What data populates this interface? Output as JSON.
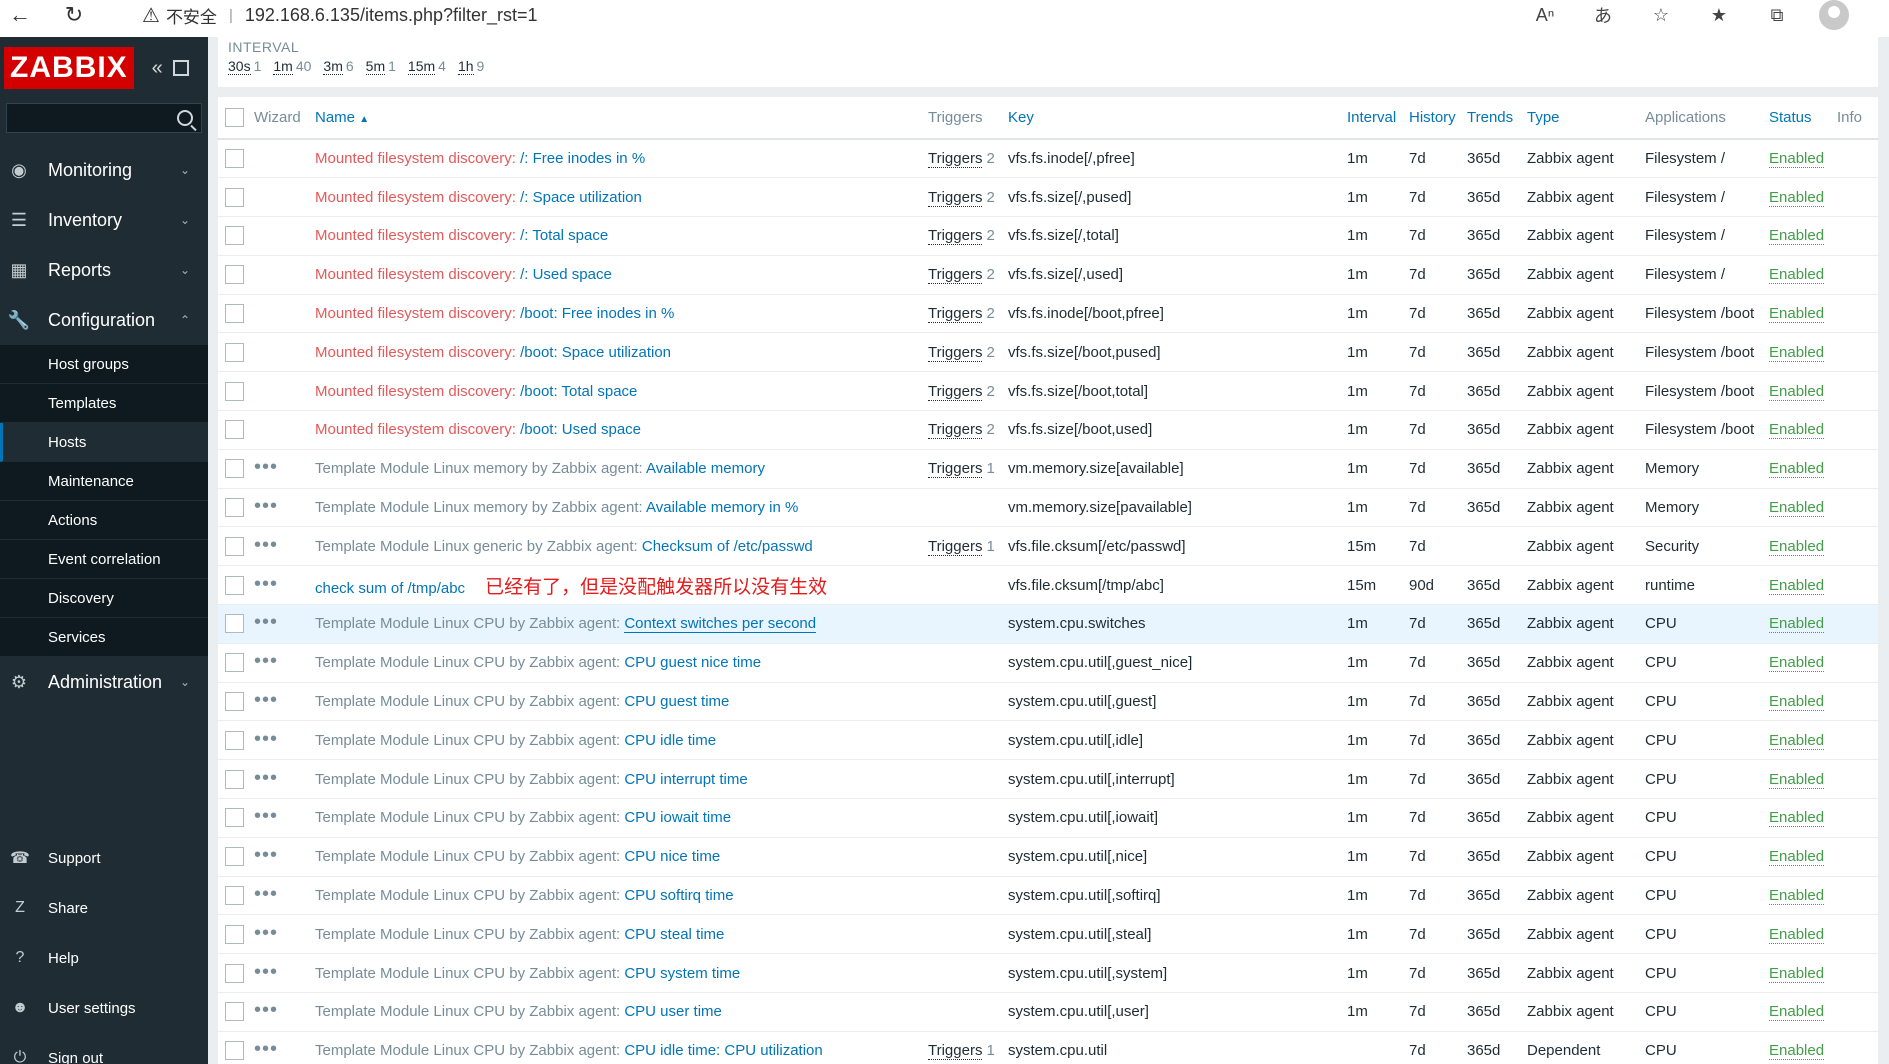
{
  "browser": {
    "security_label": "不安全",
    "url": "192.168.6.135/items.php?filter_rst=1"
  },
  "logo": "ZABBIX",
  "sidebar": {
    "menu": [
      {
        "label": "Monitoring",
        "icon": "eye-icon"
      },
      {
        "label": "Inventory",
        "icon": "list-icon"
      },
      {
        "label": "Reports",
        "icon": "bar-chart-icon"
      },
      {
        "label": "Configuration",
        "icon": "wrench-icon"
      }
    ],
    "config_submenu": [
      "Host groups",
      "Templates",
      "Hosts",
      "Maintenance",
      "Actions",
      "Event correlation",
      "Discovery",
      "Services"
    ],
    "admin": {
      "label": "Administration",
      "icon": "gear-icon"
    },
    "bottom": [
      {
        "label": "Support",
        "icon": "headset-icon"
      },
      {
        "label": "Share",
        "icon": "share-icon"
      },
      {
        "label": "Help",
        "icon": "question-icon"
      },
      {
        "label": "User settings",
        "icon": "user-icon"
      },
      {
        "label": "Sign out",
        "icon": "power-icon"
      }
    ]
  },
  "filter": {
    "interval_label": "INTERVAL",
    "intervals": [
      {
        "name": "30s",
        "count": "1"
      },
      {
        "name": "1m",
        "count": "40"
      },
      {
        "name": "3m",
        "count": "6"
      },
      {
        "name": "5m",
        "count": "1"
      },
      {
        "name": "15m",
        "count": "4"
      },
      {
        "name": "1h",
        "count": "9"
      }
    ]
  },
  "table": {
    "headers": {
      "wizard": "Wizard",
      "name": "Name",
      "triggers": "Triggers",
      "key": "Key",
      "interval": "Interval",
      "history": "History",
      "trends": "Trends",
      "type": "Type",
      "applications": "Applications",
      "status": "Status",
      "info": "Info"
    },
    "annotation": "已经有了，但是没配触发器所以没有生效",
    "rows": [
      {
        "prefix": "Mounted filesystem discovery:",
        "prefix_style": "red",
        "name": "/: Free inodes in %",
        "wizard": false,
        "triggers": "Triggers",
        "trig_count": "2",
        "key": "vfs.fs.inode[/,pfree]",
        "interval": "1m",
        "history": "7d",
        "trends": "365d",
        "type": "Zabbix agent",
        "app": "Filesystem /",
        "status": "Enabled"
      },
      {
        "prefix": "Mounted filesystem discovery:",
        "prefix_style": "red",
        "name": "/: Space utilization",
        "wizard": false,
        "triggers": "Triggers",
        "trig_count": "2",
        "key": "vfs.fs.size[/,pused]",
        "interval": "1m",
        "history": "7d",
        "trends": "365d",
        "type": "Zabbix agent",
        "app": "Filesystem /",
        "status": "Enabled"
      },
      {
        "prefix": "Mounted filesystem discovery:",
        "prefix_style": "red",
        "name": "/: Total space",
        "wizard": false,
        "triggers": "Triggers",
        "trig_count": "2",
        "key": "vfs.fs.size[/,total]",
        "interval": "1m",
        "history": "7d",
        "trends": "365d",
        "type": "Zabbix agent",
        "app": "Filesystem /",
        "status": "Enabled"
      },
      {
        "prefix": "Mounted filesystem discovery:",
        "prefix_style": "red",
        "name": "/: Used space",
        "wizard": false,
        "triggers": "Triggers",
        "trig_count": "2",
        "key": "vfs.fs.size[/,used]",
        "interval": "1m",
        "history": "7d",
        "trends": "365d",
        "type": "Zabbix agent",
        "app": "Filesystem /",
        "status": "Enabled"
      },
      {
        "prefix": "Mounted filesystem discovery:",
        "prefix_style": "red",
        "name": "/boot: Free inodes in %",
        "wizard": false,
        "triggers": "Triggers",
        "trig_count": "2",
        "key": "vfs.fs.inode[/boot,pfree]",
        "interval": "1m",
        "history": "7d",
        "trends": "365d",
        "type": "Zabbix agent",
        "app": "Filesystem /boot",
        "status": "Enabled"
      },
      {
        "prefix": "Mounted filesystem discovery:",
        "prefix_style": "red",
        "name": "/boot: Space utilization",
        "wizard": false,
        "triggers": "Triggers",
        "trig_count": "2",
        "key": "vfs.fs.size[/boot,pused]",
        "interval": "1m",
        "history": "7d",
        "trends": "365d",
        "type": "Zabbix agent",
        "app": "Filesystem /boot",
        "status": "Enabled"
      },
      {
        "prefix": "Mounted filesystem discovery:",
        "prefix_style": "red",
        "name": "/boot: Total space",
        "wizard": false,
        "triggers": "Triggers",
        "trig_count": "2",
        "key": "vfs.fs.size[/boot,total]",
        "interval": "1m",
        "history": "7d",
        "trends": "365d",
        "type": "Zabbix agent",
        "app": "Filesystem /boot",
        "status": "Enabled"
      },
      {
        "prefix": "Mounted filesystem discovery:",
        "prefix_style": "red",
        "name": "/boot: Used space",
        "wizard": false,
        "triggers": "Triggers",
        "trig_count": "2",
        "key": "vfs.fs.size[/boot,used]",
        "interval": "1m",
        "history": "7d",
        "trends": "365d",
        "type": "Zabbix agent",
        "app": "Filesystem /boot",
        "status": "Enabled"
      },
      {
        "prefix": "Template Module Linux memory by Zabbix agent:",
        "prefix_style": "gray",
        "name": "Available memory",
        "wizard": true,
        "triggers": "Triggers",
        "trig_count": "1",
        "key": "vm.memory.size[available]",
        "interval": "1m",
        "history": "7d",
        "trends": "365d",
        "type": "Zabbix agent",
        "app": "Memory",
        "status": "Enabled"
      },
      {
        "prefix": "Template Module Linux memory by Zabbix agent:",
        "prefix_style": "gray",
        "name": "Available memory in %",
        "wizard": true,
        "triggers": "",
        "trig_count": "",
        "key": "vm.memory.size[pavailable]",
        "interval": "1m",
        "history": "7d",
        "trends": "365d",
        "type": "Zabbix agent",
        "app": "Memory",
        "status": "Enabled"
      },
      {
        "prefix": "Template Module Linux generic by Zabbix agent:",
        "prefix_style": "gray",
        "name": "Checksum of /etc/passwd",
        "wizard": true,
        "triggers": "Triggers",
        "trig_count": "1",
        "key": "vfs.file.cksum[/etc/passwd]",
        "interval": "15m",
        "history": "7d",
        "trends": "",
        "type": "Zabbix agent",
        "app": "Security",
        "status": "Enabled"
      },
      {
        "prefix": "",
        "prefix_style": "none",
        "name": "check sum of /tmp/abc",
        "wizard": true,
        "triggers": "",
        "trig_count": "",
        "key": "vfs.file.cksum[/tmp/abc]",
        "interval": "15m",
        "history": "90d",
        "trends": "365d",
        "type": "Zabbix agent",
        "app": "runtime",
        "status": "Enabled",
        "annotated": true
      },
      {
        "prefix": "Template Module Linux CPU by Zabbix agent:",
        "prefix_style": "gray",
        "name": "Context switches per second",
        "wizard": true,
        "triggers": "",
        "trig_count": "",
        "key": "system.cpu.switches",
        "interval": "1m",
        "history": "7d",
        "trends": "365d",
        "type": "Zabbix agent",
        "app": "CPU",
        "status": "Enabled",
        "hover": true
      },
      {
        "prefix": "Template Module Linux CPU by Zabbix agent:",
        "prefix_style": "gray",
        "name": "CPU guest nice time",
        "wizard": true,
        "triggers": "",
        "trig_count": "",
        "key": "system.cpu.util[,guest_nice]",
        "interval": "1m",
        "history": "7d",
        "trends": "365d",
        "type": "Zabbix agent",
        "app": "CPU",
        "status": "Enabled"
      },
      {
        "prefix": "Template Module Linux CPU by Zabbix agent:",
        "prefix_style": "gray",
        "name": "CPU guest time",
        "wizard": true,
        "triggers": "",
        "trig_count": "",
        "key": "system.cpu.util[,guest]",
        "interval": "1m",
        "history": "7d",
        "trends": "365d",
        "type": "Zabbix agent",
        "app": "CPU",
        "status": "Enabled"
      },
      {
        "prefix": "Template Module Linux CPU by Zabbix agent:",
        "prefix_style": "gray",
        "name": "CPU idle time",
        "wizard": true,
        "triggers": "",
        "trig_count": "",
        "key": "system.cpu.util[,idle]",
        "interval": "1m",
        "history": "7d",
        "trends": "365d",
        "type": "Zabbix agent",
        "app": "CPU",
        "status": "Enabled"
      },
      {
        "prefix": "Template Module Linux CPU by Zabbix agent:",
        "prefix_style": "gray",
        "name": "CPU interrupt time",
        "wizard": true,
        "triggers": "",
        "trig_count": "",
        "key": "system.cpu.util[,interrupt]",
        "interval": "1m",
        "history": "7d",
        "trends": "365d",
        "type": "Zabbix agent",
        "app": "CPU",
        "status": "Enabled"
      },
      {
        "prefix": "Template Module Linux CPU by Zabbix agent:",
        "prefix_style": "gray",
        "name": "CPU iowait time",
        "wizard": true,
        "triggers": "",
        "trig_count": "",
        "key": "system.cpu.util[,iowait]",
        "interval": "1m",
        "history": "7d",
        "trends": "365d",
        "type": "Zabbix agent",
        "app": "CPU",
        "status": "Enabled"
      },
      {
        "prefix": "Template Module Linux CPU by Zabbix agent:",
        "prefix_style": "gray",
        "name": "CPU nice time",
        "wizard": true,
        "triggers": "",
        "trig_count": "",
        "key": "system.cpu.util[,nice]",
        "interval": "1m",
        "history": "7d",
        "trends": "365d",
        "type": "Zabbix agent",
        "app": "CPU",
        "status": "Enabled"
      },
      {
        "prefix": "Template Module Linux CPU by Zabbix agent:",
        "prefix_style": "gray",
        "name": "CPU softirq time",
        "wizard": true,
        "triggers": "",
        "trig_count": "",
        "key": "system.cpu.util[,softirq]",
        "interval": "1m",
        "history": "7d",
        "trends": "365d",
        "type": "Zabbix agent",
        "app": "CPU",
        "status": "Enabled"
      },
      {
        "prefix": "Template Module Linux CPU by Zabbix agent:",
        "prefix_style": "gray",
        "name": "CPU steal time",
        "wizard": true,
        "triggers": "",
        "trig_count": "",
        "key": "system.cpu.util[,steal]",
        "interval": "1m",
        "history": "7d",
        "trends": "365d",
        "type": "Zabbix agent",
        "app": "CPU",
        "status": "Enabled"
      },
      {
        "prefix": "Template Module Linux CPU by Zabbix agent:",
        "prefix_style": "gray",
        "name": "CPU system time",
        "wizard": true,
        "triggers": "",
        "trig_count": "",
        "key": "system.cpu.util[,system]",
        "interval": "1m",
        "history": "7d",
        "trends": "365d",
        "type": "Zabbix agent",
        "app": "CPU",
        "status": "Enabled"
      },
      {
        "prefix": "Template Module Linux CPU by Zabbix agent:",
        "prefix_style": "gray",
        "name": "CPU user time",
        "wizard": true,
        "triggers": "",
        "trig_count": "",
        "key": "system.cpu.util[,user]",
        "interval": "1m",
        "history": "7d",
        "trends": "365d",
        "type": "Zabbix agent",
        "app": "CPU",
        "status": "Enabled"
      },
      {
        "prefix": "Template Module Linux CPU by Zabbix agent:",
        "prefix_style": "gray",
        "name": "CPU idle time: CPU utilization",
        "wizard": true,
        "triggers": "Triggers",
        "trig_count": "1",
        "key": "system.cpu.util",
        "interval": "",
        "history": "7d",
        "trends": "365d",
        "type": "Dependent",
        "app": "CPU",
        "status": "Enabled"
      }
    ]
  }
}
